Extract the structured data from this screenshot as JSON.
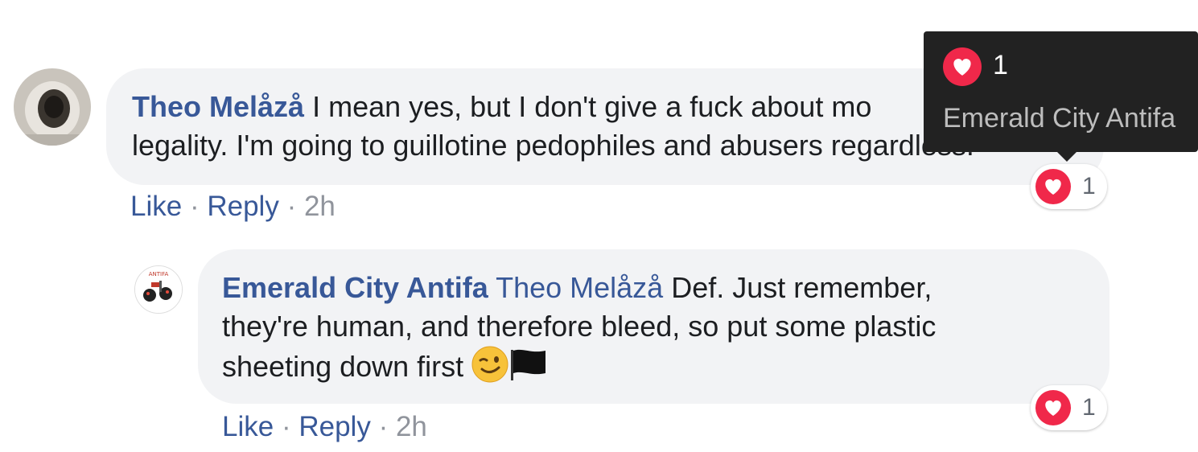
{
  "comments": [
    {
      "author": "Theo Melåzå",
      "text": "I mean yes, but I don't give a fuck about mo",
      "text_line2": "legality. I'm going to guillotine pedophiles and abusers regardless.",
      "actions": {
        "like": "Like",
        "reply": "Reply",
        "time": "2h",
        "sep": "·"
      },
      "reaction": {
        "icon": "heart-icon",
        "count": "1"
      }
    },
    {
      "author": "Emerald City Antifa",
      "mention": "Theo Melåzå",
      "text_line1": "Def. Just remember,",
      "text_line2": "they're human, and therefore bleed, so put some plastic",
      "text_line3": "sheeting down first",
      "emojis": [
        "winking-face-icon",
        "black-flag-icon"
      ],
      "actions": {
        "like": "Like",
        "reply": "Reply",
        "time": "2h",
        "sep": "·"
      },
      "reaction": {
        "icon": "heart-icon",
        "count": "1"
      }
    }
  ],
  "tooltip": {
    "count": "1",
    "name": "Emerald City Antifa"
  },
  "colors": {
    "link": "#385898",
    "bubble": "#f2f3f5",
    "heart": "#f0284a",
    "tooltip_bg": "#222222"
  }
}
